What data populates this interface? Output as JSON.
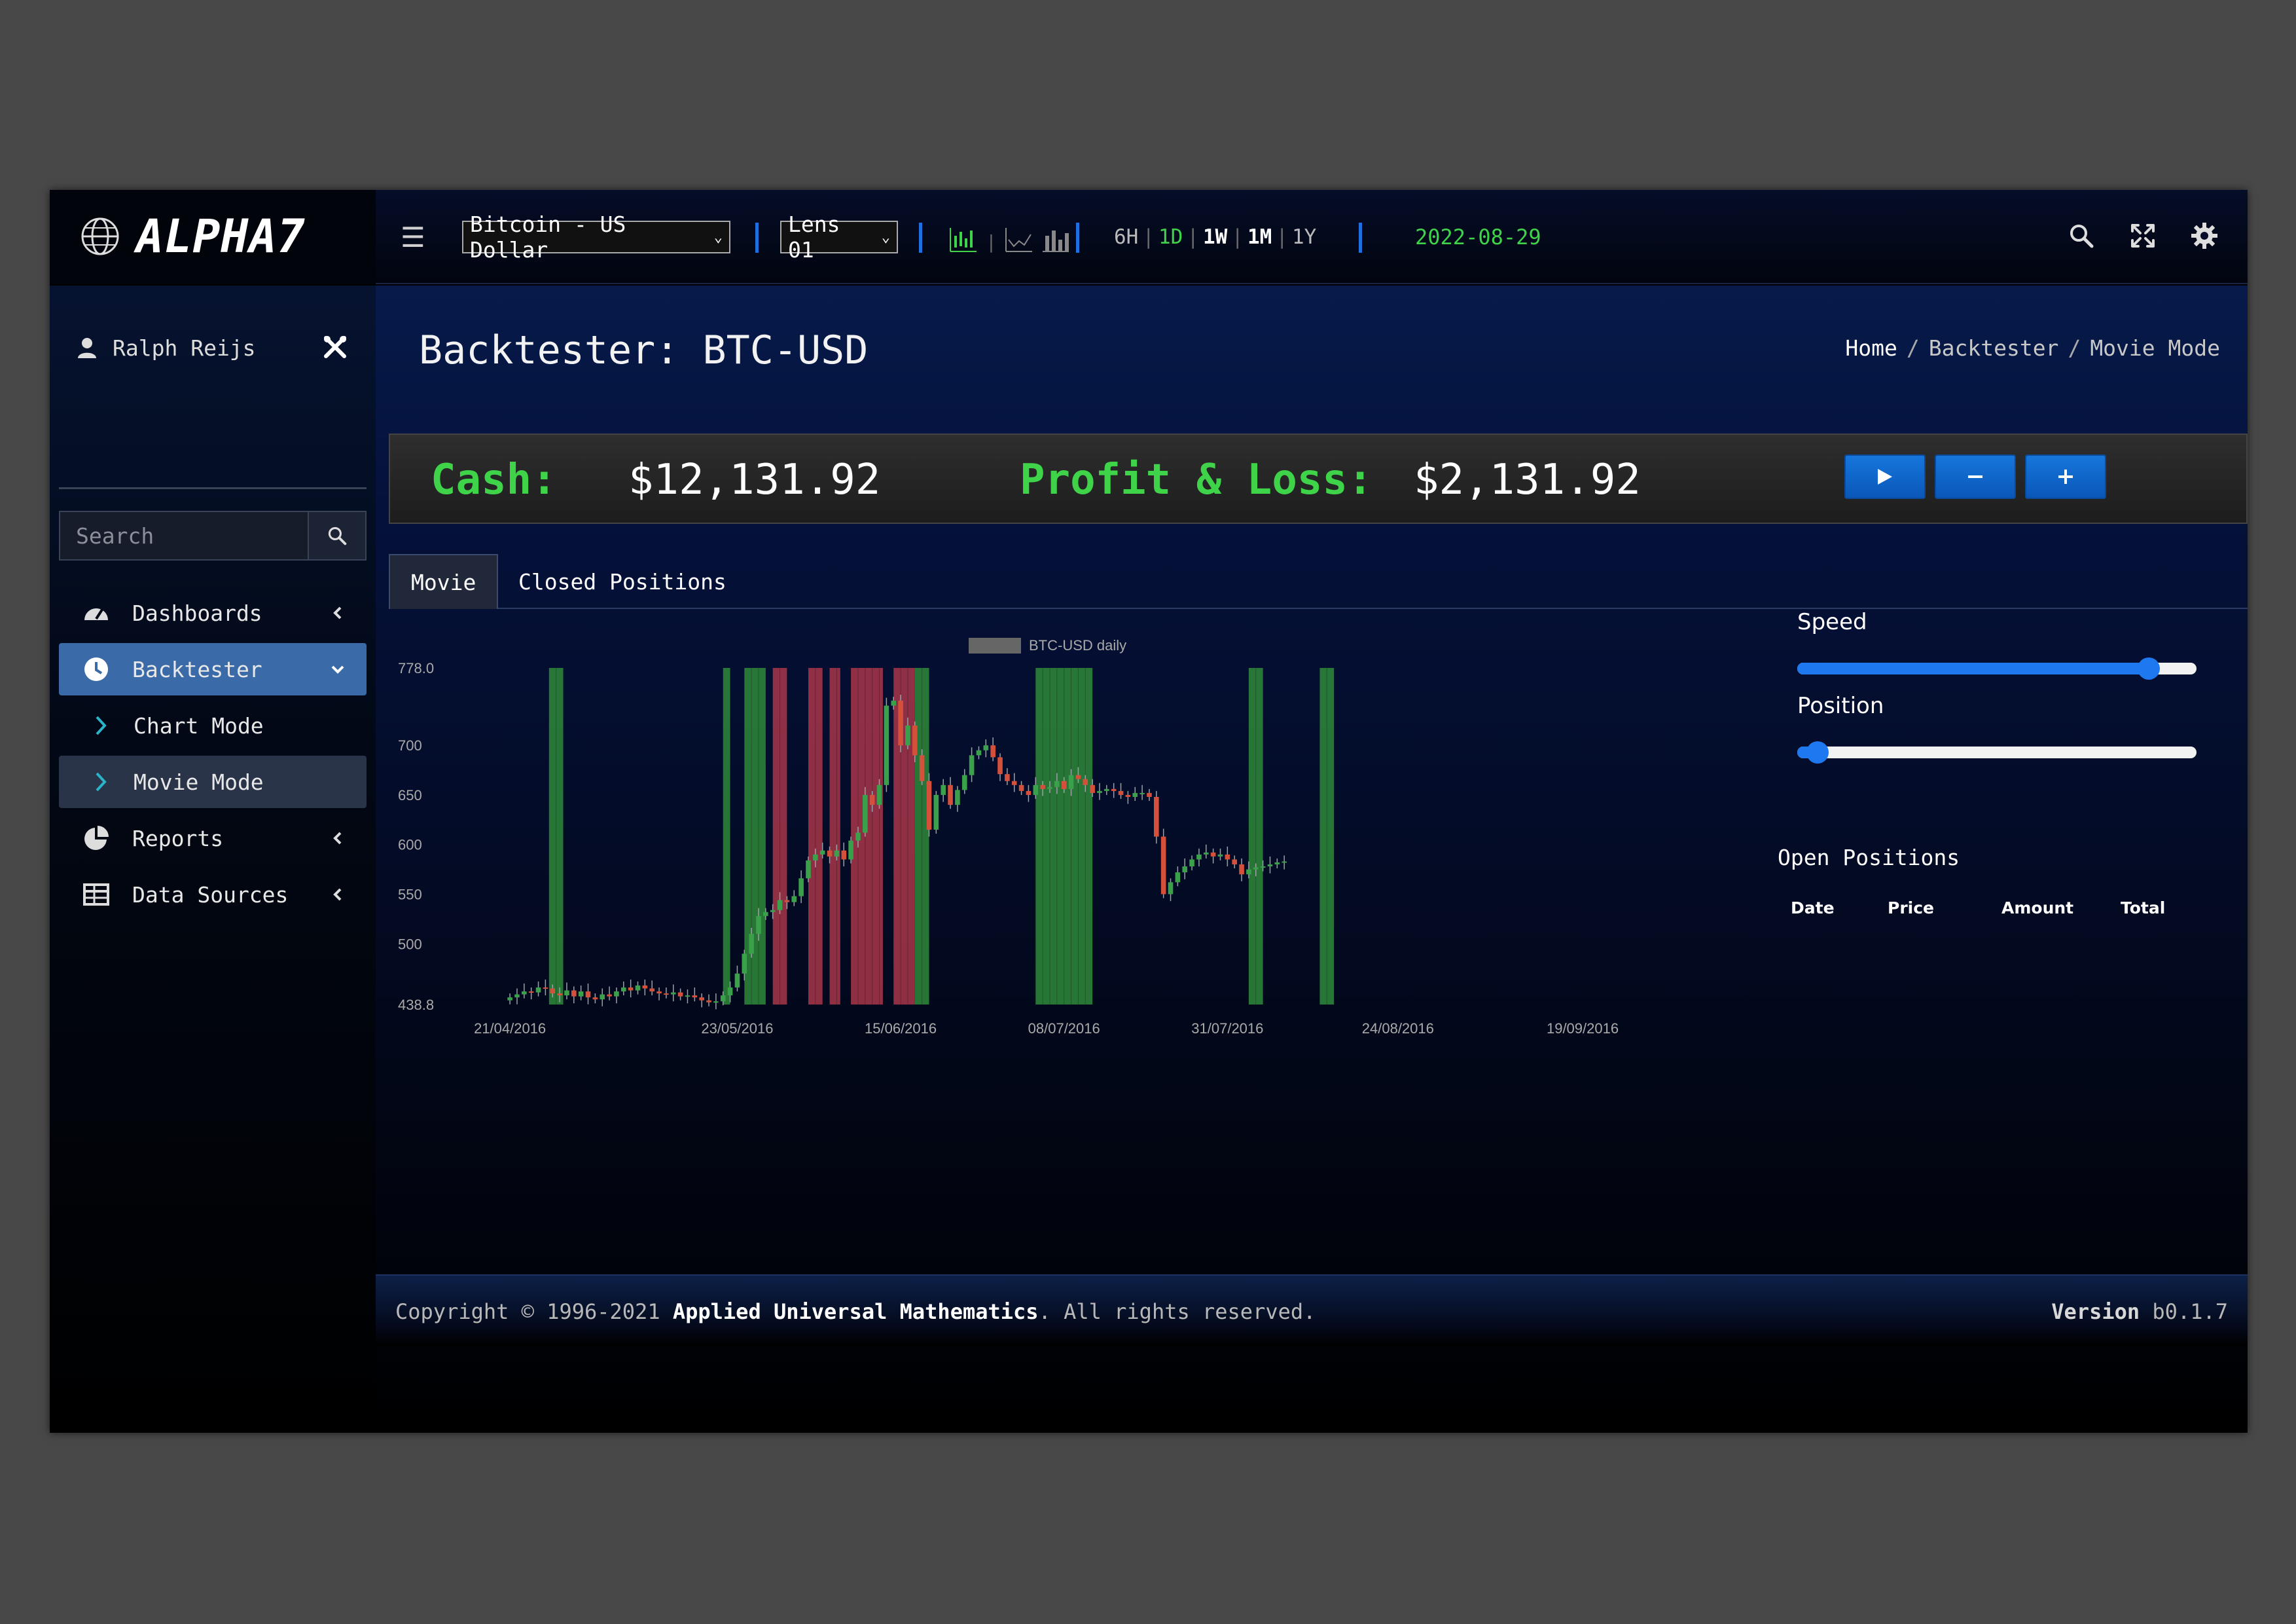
{
  "app": {
    "logo": "ALPHA7"
  },
  "toolbar": {
    "pair_select": "Bitcoin - US Dollar",
    "lens_select": "Lens 01",
    "timeframes": [
      "6H",
      "1D",
      "1W",
      "1M",
      "1Y"
    ],
    "date": "2022-08-29",
    "chart_icons": [
      "candlestick-chart-icon",
      "line-chart-icon",
      "bar-chart-icon"
    ],
    "right_icons": [
      "search-icon",
      "fullscreen-icon",
      "gear-icon"
    ]
  },
  "sidebar": {
    "user": "Ralph Reijs",
    "search_placeholder": "Search",
    "items": [
      {
        "label": "Dashboards",
        "icon": "dashboard-icon"
      },
      {
        "label": "Backtester",
        "icon": "clock-icon",
        "active": true
      },
      {
        "label": "Chart Mode",
        "icon": "chevron-right-icon"
      },
      {
        "label": "Movie Mode",
        "icon": "chevron-right-icon",
        "active": true
      },
      {
        "label": "Reports",
        "icon": "pie-chart-icon"
      },
      {
        "label": "Data Sources",
        "icon": "table-icon"
      }
    ]
  },
  "page": {
    "title": "Backtester: BTC-USD",
    "breadcrumb": [
      "Home",
      "Backtester",
      "Movie Mode"
    ]
  },
  "summary": {
    "cash_label": "Cash:",
    "cash_value": "$12,131.92",
    "pnl_label": "Profit & Loss:",
    "pnl_value": "$2,131.92",
    "buttons": [
      "play",
      "minus",
      "plus"
    ]
  },
  "tabs": [
    "Movie",
    "Closed Positions"
  ],
  "controls": {
    "speed_label": "Speed",
    "speed_value": 0.88,
    "position_label": "Position",
    "position_value": 0.05
  },
  "open_positions": {
    "title": "Open Positions",
    "columns": [
      "Date",
      "Price",
      "Amount",
      "Total"
    ]
  },
  "footer": {
    "copyright_prefix": "Copyright © 1996-2021 ",
    "company": "Applied Universal Mathematics",
    "copyright_suffix": ". All rights reserved.",
    "version_label": "Version",
    "version": "b0.1.7"
  },
  "chart_data": {
    "type": "candlestick",
    "legend": "BTC-USD daily",
    "y_ticks": [
      "778.0",
      "700",
      "650",
      "600",
      "550",
      "500",
      "438.8"
    ],
    "y_tick_values": [
      778.0,
      700,
      650,
      600,
      550,
      500,
      438.8
    ],
    "ylim": [
      438.8,
      778.0
    ],
    "x_ticks": [
      "21/04/2016",
      "23/05/2016",
      "15/06/2016",
      "08/07/2016",
      "31/07/2016",
      "24/08/2016",
      "19/09/2016"
    ],
    "x_tick_days": [
      0,
      32,
      55,
      78,
      101,
      125,
      151
    ],
    "xlim": [
      -6,
      158
    ],
    "close": [
      446,
      449,
      452,
      451,
      456,
      455,
      450,
      448,
      453,
      447,
      452,
      446,
      444,
      449,
      447,
      452,
      456,
      453,
      458,
      455,
      452,
      450,
      449,
      451,
      447,
      448,
      446,
      443,
      441,
      442,
      448,
      456,
      470,
      490,
      510,
      528,
      532,
      534,
      544,
      542,
      548,
      566,
      584,
      590,
      594,
      588,
      594,
      585,
      604,
      612,
      650,
      640,
      660,
      740,
      745,
      700,
      720,
      690,
      664,
      615,
      650,
      660,
      640,
      655,
      670,
      690,
      695,
      700,
      688,
      671,
      664,
      660,
      654,
      650,
      660,
      656,
      658,
      664,
      656,
      670,
      666,
      660,
      652,
      654,
      656,
      654,
      650,
      648,
      652,
      652,
      648,
      608,
      550,
      562,
      572,
      578,
      585,
      590,
      592,
      588,
      590,
      585,
      580,
      570,
      575,
      577,
      578,
      580,
      582,
      583
    ],
    "bands": [
      {
        "from": 5.5,
        "to": 7.5,
        "color": "green"
      },
      {
        "from": 30,
        "to": 31,
        "color": "green"
      },
      {
        "from": 33,
        "to": 36,
        "color": "green"
      },
      {
        "from": 37,
        "to": 39,
        "color": "red"
      },
      {
        "from": 42,
        "to": 44,
        "color": "red"
      },
      {
        "from": 45,
        "to": 46.5,
        "color": "red"
      },
      {
        "from": 48,
        "to": 52.5,
        "color": "red"
      },
      {
        "from": 54,
        "to": 57,
        "color": "red"
      },
      {
        "from": 57,
        "to": 59,
        "color": "green"
      },
      {
        "from": 74,
        "to": 82,
        "color": "green"
      },
      {
        "from": 104,
        "to": 106,
        "color": "green"
      },
      {
        "from": 114,
        "to": 116,
        "color": "green"
      }
    ]
  },
  "colors": {
    "accent": "#1e78f0",
    "green_text": "#3fd34a",
    "candle_up": "#3aa04a",
    "candle_down": "#d4503a"
  }
}
